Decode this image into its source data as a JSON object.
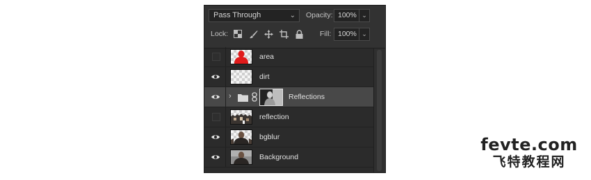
{
  "blend_mode": {
    "value": "Pass Through"
  },
  "opacity": {
    "label": "Opacity:",
    "value": "100%"
  },
  "lock": {
    "label": "Lock:",
    "icons": [
      "lock-transparent-pixels-icon",
      "lock-image-pixels-icon",
      "lock-position-icon",
      "lock-artboard-icon",
      "lock-all-icon"
    ]
  },
  "fill": {
    "label": "Fill:",
    "value": "100%"
  },
  "layers": [
    {
      "name": "area",
      "visible": false,
      "thumbnail": "red-silhouette-on-transparent"
    },
    {
      "name": "dirt",
      "visible": true,
      "thumbnail": "transparent"
    },
    {
      "name": "Reflections",
      "visible": true,
      "type": "group",
      "selected": true,
      "has_mask": true
    },
    {
      "name": "reflection",
      "visible": false,
      "thumbnail": "photo-with-transparency"
    },
    {
      "name": "bgblur",
      "visible": true,
      "thumbnail": "portrait-on-transparent"
    },
    {
      "name": "Background",
      "visible": true,
      "thumbnail": "portrait-photo"
    }
  ],
  "watermark": {
    "line1": "fevte.com",
    "line2": "飞特教程网"
  },
  "colors": {
    "panel_bg": "#2b2b2b",
    "selected_row": "#484848",
    "area_thumb_red": "#e01b1b"
  }
}
